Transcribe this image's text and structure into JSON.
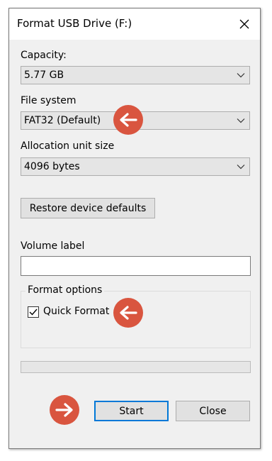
{
  "window": {
    "title": "Format USB Drive (F:)"
  },
  "capacity": {
    "label": "Capacity:",
    "value": "5.77 GB"
  },
  "file_system": {
    "label": "File system",
    "value": "FAT32 (Default)"
  },
  "allocation": {
    "label": "Allocation unit size",
    "value": "4096 bytes"
  },
  "restore_button": {
    "label": "Restore device defaults"
  },
  "volume": {
    "label": "Volume label",
    "value": ""
  },
  "format_options": {
    "legend": "Format options",
    "quick_format_label": "Quick Format",
    "quick_format_checked": true
  },
  "progress": {
    "value": 0
  },
  "buttons": {
    "start": "Start",
    "close": "Close"
  },
  "icons": {
    "close": "close-icon",
    "dropdown": "chevron-down-icon",
    "check": "checkmark-icon",
    "annotation_left": "arrow-left-icon",
    "annotation_right": "arrow-right-icon"
  },
  "colors": {
    "window_bg": "#f0f0f0",
    "titlebar_bg": "#ffffff",
    "default_button_border": "#0078d7",
    "annotation_marker": "#d9553f"
  }
}
